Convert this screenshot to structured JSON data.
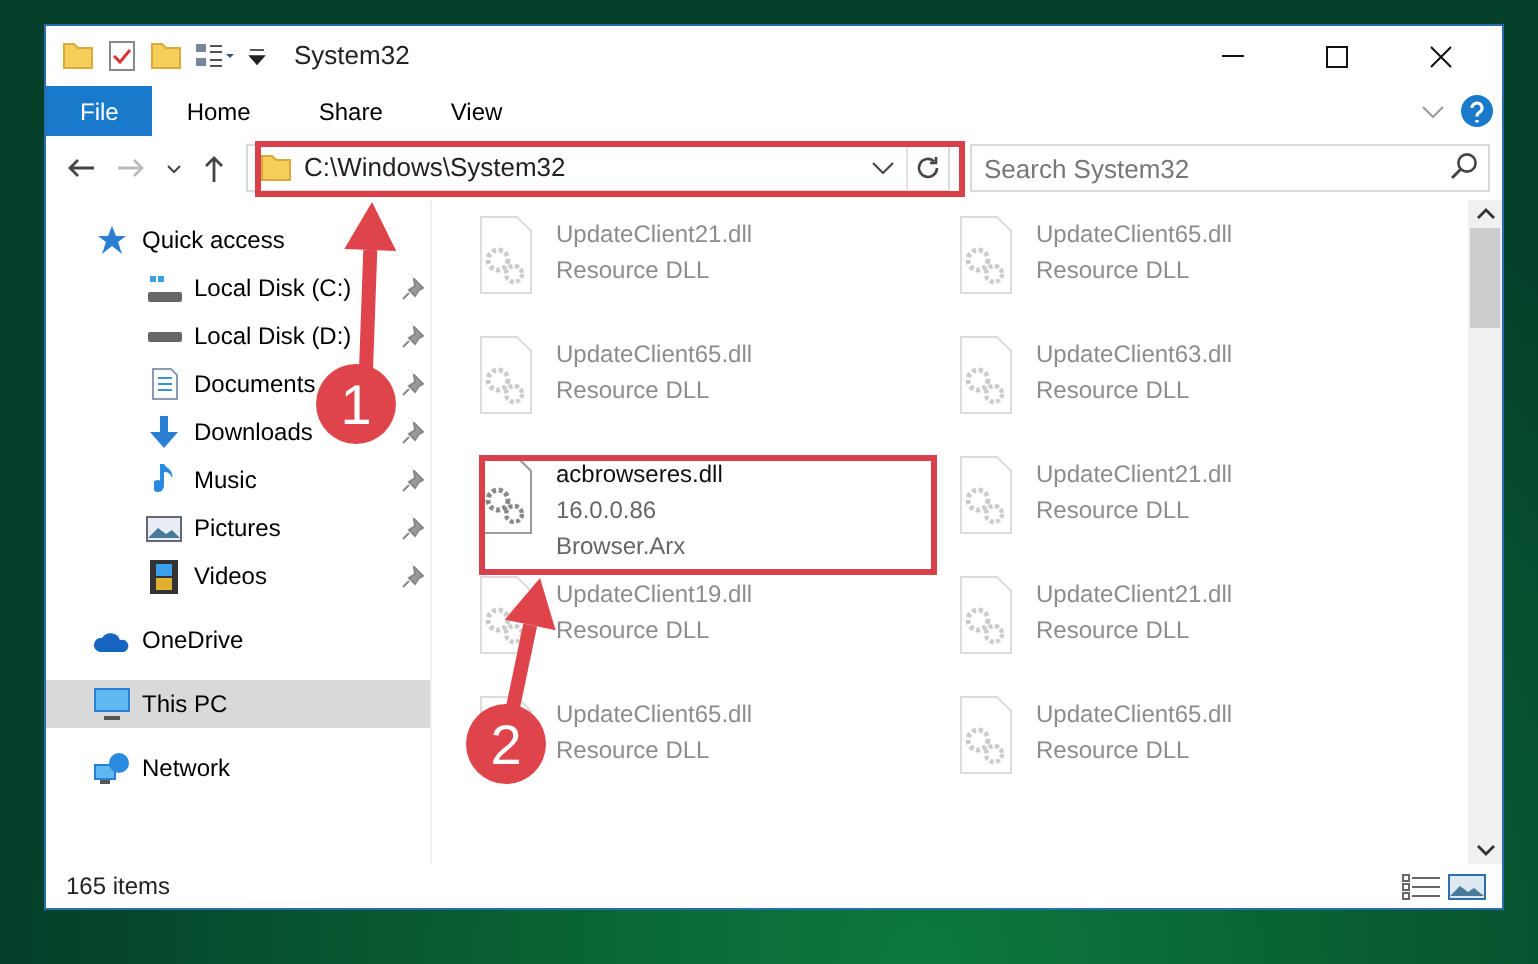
{
  "window": {
    "title": "System32"
  },
  "ribbon_tabs": [
    {
      "label": "File",
      "selected": true
    },
    {
      "label": "Home",
      "selected": false
    },
    {
      "label": "Share",
      "selected": false
    },
    {
      "label": "View",
      "selected": false
    }
  ],
  "address": {
    "path": "C:\\Windows\\System32"
  },
  "search": {
    "placeholder": "Search System32"
  },
  "sidebar": {
    "items": [
      {
        "label": "Quick access",
        "selected": false,
        "children": [
          {
            "label": "Local Disk (C:)",
            "selected": false,
            "pinned": true
          },
          {
            "label": "Local Disk (D:)",
            "selected": false,
            "pinned": true
          },
          {
            "label": "Documents",
            "selected": false,
            "pinned": true
          },
          {
            "label": "Downloads",
            "selected": false,
            "pinned": true
          },
          {
            "label": "Music",
            "selected": false,
            "pinned": true
          },
          {
            "label": "Pictures",
            "selected": false,
            "pinned": true
          },
          {
            "label": "Videos",
            "selected": false,
            "pinned": true
          }
        ]
      },
      {
        "label": "OneDrive",
        "selected": false
      },
      {
        "label": "This PC",
        "selected": true
      },
      {
        "label": "Network",
        "selected": false
      }
    ]
  },
  "files": [
    {
      "name": "UpdateClient21.dll",
      "lines": [
        "Resource DLL"
      ],
      "blurred": true
    },
    {
      "name": "UpdateClient65.dll",
      "lines": [
        "Resource DLL"
      ],
      "blurred": true
    },
    {
      "name": "UpdateClient65.dll",
      "lines": [
        "Resource DLL"
      ],
      "blurred": true
    },
    {
      "name": "UpdateClient63.dll",
      "lines": [
        "Resource DLL"
      ],
      "blurred": true
    },
    {
      "name": "acbrowseres.dll",
      "lines": [
        "16.0.0.86",
        "Browser.Arx"
      ],
      "blurred": false
    },
    {
      "name": "UpdateClient21.dll",
      "lines": [
        "Resource DLL"
      ],
      "blurred": true
    },
    {
      "name": "UpdateClient19.dll",
      "lines": [
        "Resource DLL"
      ],
      "blurred": true
    },
    {
      "name": "UpdateClient21.dll",
      "lines": [
        "Resource DLL"
      ],
      "blurred": true
    },
    {
      "name": "UpdateClient65.dll",
      "lines": [
        "Resource DLL"
      ],
      "blurred": true
    },
    {
      "name": "UpdateClient65.dll",
      "lines": [
        "Resource DLL"
      ],
      "blurred": true
    }
  ],
  "status_bar": {
    "count": "165 items"
  },
  "callouts": [
    {
      "label": "1"
    },
    {
      "label": "2"
    }
  ]
}
